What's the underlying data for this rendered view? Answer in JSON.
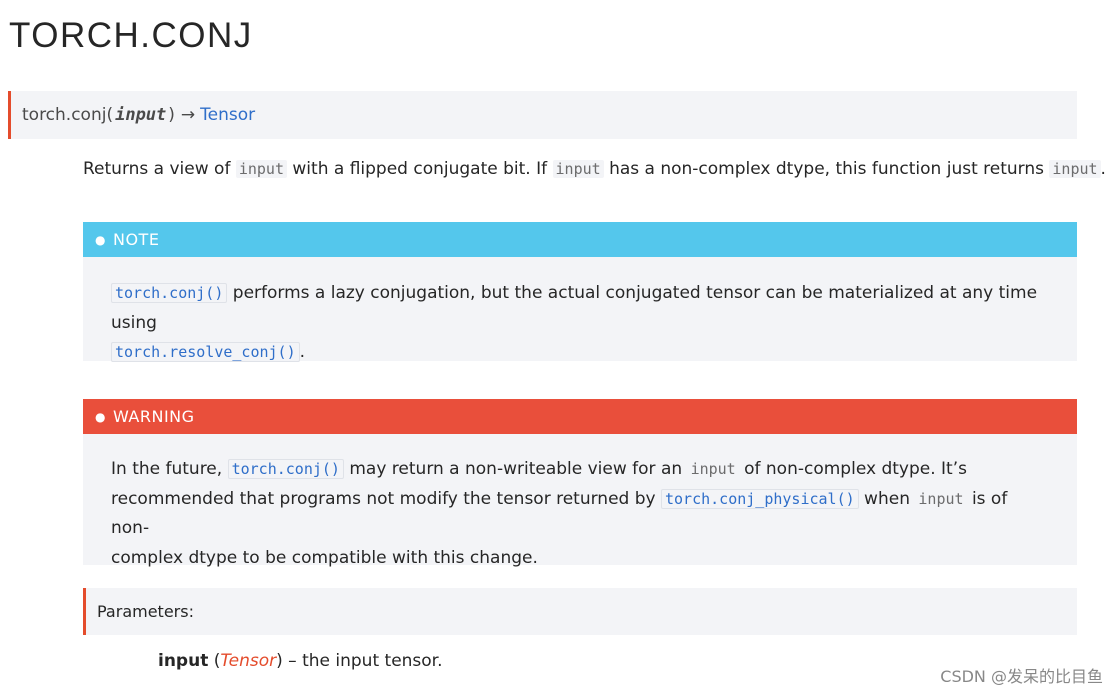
{
  "page": {
    "title": "TORCH.CONJ"
  },
  "signature": {
    "name": "torch.conj",
    "open_paren": "(",
    "param": "input",
    "close_paren": ")",
    "arrow": "→",
    "return_type": "Tensor"
  },
  "description": {
    "t1": "Returns a view of ",
    "c1": "input",
    "t2": " with a flipped conjugate bit. If ",
    "c2": "input",
    "t3": " has a non-complex dtype, this function just returns ",
    "c3": "input",
    "t4": "."
  },
  "note": {
    "label": "NOTE",
    "c1": "torch.conj()",
    "t1": " performs a lazy conjugation, but the actual conjugated tensor can be materialized at any time using",
    "c2": "torch.resolve_conj()",
    "t2": "."
  },
  "warning": {
    "label": "WARNING",
    "t1": "In the future, ",
    "c1": "torch.conj()",
    "t2": " may return a non-writeable view for an ",
    "c2": "input",
    "t3": " of non-complex dtype. It’s",
    "t4": "recommended that programs not modify the tensor returned by ",
    "c3": "torch.conj_physical()",
    "t5": " when ",
    "c4": "input",
    "t6": " is of non-",
    "t7": "complex dtype to be compatible with this change."
  },
  "parameters": {
    "label": "Parameters:",
    "items": [
      {
        "name": "input",
        "open": " (",
        "type": "Tensor",
        "close": ")",
        "dash": " – ",
        "desc": "the input tensor."
      }
    ]
  },
  "watermark": {
    "text": "CSDN @发呆的比目鱼"
  },
  "colors": {
    "accent": "#e44c2c",
    "note": "#54c7ec",
    "warning": "#e94f3b",
    "link": "#2f6ec9",
    "panel": "#f3f4f7"
  }
}
